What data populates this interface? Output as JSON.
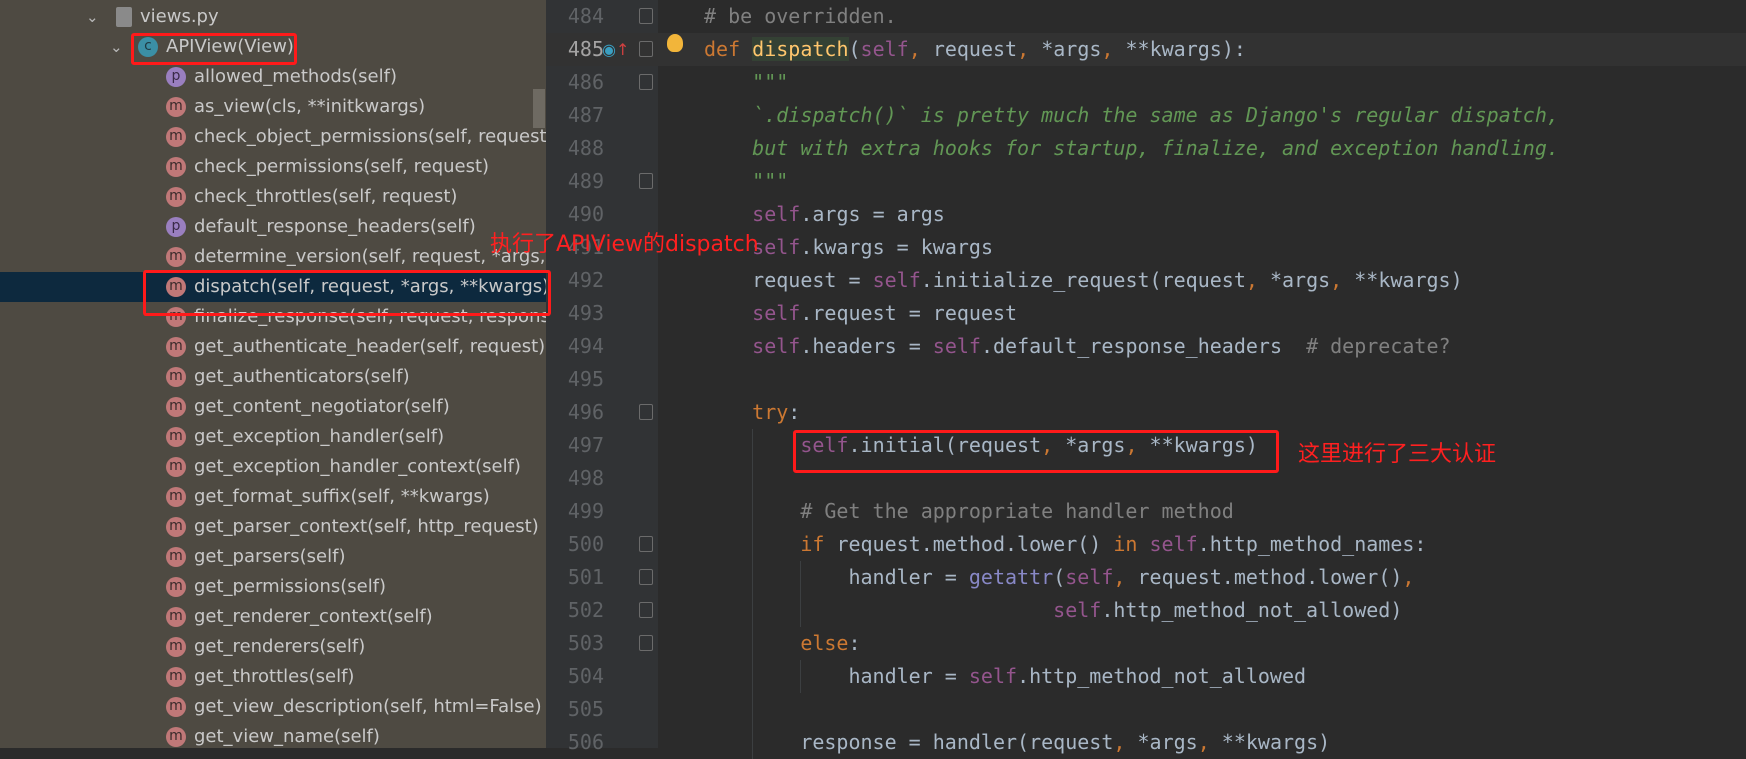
{
  "tree": {
    "file": "views.py",
    "class_name": "APIView(View)",
    "items": [
      {
        "icon": "p",
        "label": "allowed_methods(self)"
      },
      {
        "icon": "m",
        "label": "as_view(cls, **initkwargs)"
      },
      {
        "icon": "m",
        "label": "check_object_permissions(self, request, obj)"
      },
      {
        "icon": "m",
        "label": "check_permissions(self, request)"
      },
      {
        "icon": "m",
        "label": "check_throttles(self, request)"
      },
      {
        "icon": "p",
        "label": "default_response_headers(self)"
      },
      {
        "icon": "m",
        "label": "determine_version(self, request, *args, **kwargs)"
      },
      {
        "icon": "m",
        "label": "dispatch(self, request, *args, **kwargs)",
        "selected": true
      },
      {
        "icon": "m",
        "label": "finalize_response(self, request, response, *args, **kwargs)"
      },
      {
        "icon": "m",
        "label": "get_authenticate_header(self, request)"
      },
      {
        "icon": "m",
        "label": "get_authenticators(self)"
      },
      {
        "icon": "m",
        "label": "get_content_negotiator(self)"
      },
      {
        "icon": "m",
        "label": "get_exception_handler(self)"
      },
      {
        "icon": "m",
        "label": "get_exception_handler_context(self)"
      },
      {
        "icon": "m",
        "label": "get_format_suffix(self, **kwargs)"
      },
      {
        "icon": "m",
        "label": "get_parser_context(self, http_request)"
      },
      {
        "icon": "m",
        "label": "get_parsers(self)"
      },
      {
        "icon": "m",
        "label": "get_permissions(self)"
      },
      {
        "icon": "m",
        "label": "get_renderer_context(self)"
      },
      {
        "icon": "m",
        "label": "get_renderers(self)"
      },
      {
        "icon": "m",
        "label": "get_throttles(self)"
      },
      {
        "icon": "m",
        "label": "get_view_description(self, html=False)"
      },
      {
        "icon": "m",
        "label": "get_view_name(self)"
      }
    ]
  },
  "annotations": {
    "dispatch_note": "执行了APIView的dispatch",
    "initial_note": "这里进行了三大认证"
  },
  "code": {
    "current_line": 485,
    "lines": [
      {
        "n": 484,
        "i": 0,
        "fold": true,
        "t": [
          [
            "cm",
            "# be overridden."
          ]
        ]
      },
      {
        "n": 485,
        "i": 0,
        "fold": true,
        "t": [
          [
            "kw",
            "def "
          ],
          [
            "fn",
            "dispatch"
          ],
          [
            "pl",
            "("
          ],
          [
            "self",
            "self"
          ],
          [
            "cma",
            ", "
          ],
          [
            "pl",
            "request"
          ],
          [
            "cma",
            ", "
          ],
          [
            "pl",
            "*args"
          ],
          [
            "cma",
            ", "
          ],
          [
            "pl",
            "**kwargs):"
          ]
        ]
      },
      {
        "n": 486,
        "i": 1,
        "fold": true,
        "t": [
          [
            "doc",
            "\"\"\""
          ]
        ]
      },
      {
        "n": 487,
        "i": 1,
        "t": [
          [
            "doc",
            "`.dispatch()` is pretty much the same as Django's regular dispatch,"
          ]
        ]
      },
      {
        "n": 488,
        "i": 1,
        "t": [
          [
            "doc",
            "but with extra hooks for startup, finalize, and exception handling."
          ]
        ]
      },
      {
        "n": 489,
        "i": 1,
        "fold": true,
        "t": [
          [
            "doc",
            "\"\"\""
          ]
        ]
      },
      {
        "n": 490,
        "i": 1,
        "t": [
          [
            "self",
            "self"
          ],
          [
            "pl",
            ".args = args"
          ]
        ]
      },
      {
        "n": 491,
        "i": 1,
        "t": [
          [
            "self",
            "self"
          ],
          [
            "pl",
            ".kwargs = kwargs"
          ]
        ]
      },
      {
        "n": 492,
        "i": 1,
        "t": [
          [
            "pl",
            "request = "
          ],
          [
            "self",
            "self"
          ],
          [
            "pl",
            ".initialize_request(request"
          ],
          [
            "cma",
            ", "
          ],
          [
            "pl",
            "*args"
          ],
          [
            "cma",
            ", "
          ],
          [
            "pl",
            "**kwargs)"
          ]
        ]
      },
      {
        "n": 493,
        "i": 1,
        "t": [
          [
            "self",
            "self"
          ],
          [
            "pl",
            ".request = request"
          ]
        ]
      },
      {
        "n": 494,
        "i": 1,
        "t": [
          [
            "self",
            "self"
          ],
          [
            "pl",
            ".headers = "
          ],
          [
            "self",
            "self"
          ],
          [
            "pl",
            ".default_response_headers  "
          ],
          [
            "cm",
            "# deprecate?"
          ]
        ]
      },
      {
        "n": 495,
        "i": 1,
        "t": []
      },
      {
        "n": 496,
        "i": 1,
        "fold": true,
        "t": [
          [
            "kw",
            "try"
          ],
          [
            "pl",
            ":"
          ]
        ]
      },
      {
        "n": 497,
        "i": 2,
        "t": [
          [
            "self",
            "self"
          ],
          [
            "pl",
            ".initial(request"
          ],
          [
            "cma",
            ", "
          ],
          [
            "pl",
            "*args"
          ],
          [
            "cma",
            ", "
          ],
          [
            "pl",
            "**kwargs)"
          ]
        ]
      },
      {
        "n": 498,
        "i": 2,
        "t": []
      },
      {
        "n": 499,
        "i": 2,
        "t": [
          [
            "cm",
            "# Get the appropriate handler method"
          ]
        ]
      },
      {
        "n": 500,
        "i": 2,
        "fold": true,
        "t": [
          [
            "kw",
            "if "
          ],
          [
            "pl",
            "request.method.lower() "
          ],
          [
            "kw",
            "in "
          ],
          [
            "self",
            "self"
          ],
          [
            "pl",
            ".http_method_names:"
          ]
        ]
      },
      {
        "n": 501,
        "i": 3,
        "fold": true,
        "t": [
          [
            "pl",
            "handler = "
          ],
          [
            "bi",
            "getattr"
          ],
          [
            "pl",
            "("
          ],
          [
            "self",
            "self"
          ],
          [
            "cma",
            ", "
          ],
          [
            "pl",
            "request.method.lower()"
          ],
          [
            "cma",
            ","
          ]
        ]
      },
      {
        "n": 502,
        "i": -1,
        "fold": true,
        "t": [
          [
            "self",
            "self"
          ],
          [
            "pl",
            ".http_method_not_allowed)"
          ]
        ]
      },
      {
        "n": 503,
        "i": 2,
        "fold": true,
        "t": [
          [
            "kw",
            "else"
          ],
          [
            "pl",
            ":"
          ]
        ]
      },
      {
        "n": 504,
        "i": 3,
        "t": [
          [
            "pl",
            "handler = "
          ],
          [
            "self",
            "self"
          ],
          [
            "pl",
            ".http_method_not_allowed"
          ]
        ]
      },
      {
        "n": 505,
        "i": 2,
        "t": []
      },
      {
        "n": 506,
        "i": 2,
        "t": [
          [
            "pl",
            "response = handler(request"
          ],
          [
            "cma",
            ", "
          ],
          [
            "pl",
            "*args"
          ],
          [
            "cma",
            ", "
          ],
          [
            "pl",
            "**kwargs)"
          ]
        ]
      }
    ]
  },
  "colors": {
    "annotation": "#ff1a1a",
    "selection": "#0d293e"
  }
}
